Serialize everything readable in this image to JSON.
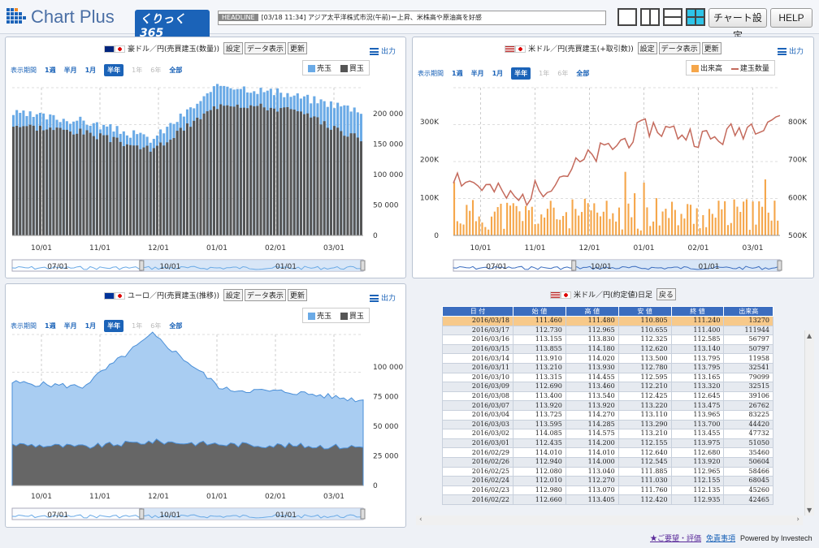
{
  "header": {
    "logo_text": "Chart Plus",
    "logo_badge": "くりっく365",
    "headline_tag": "HEADLINE",
    "headline_text": "[03/18 11:34] アジア太平洋株式市況(午前)＝上昇、米株高や原油高を好感",
    "settings_label": "チャート設定",
    "help_label": "HELP"
  },
  "common": {
    "settings_btn": "設定",
    "data_btn": "データ表示",
    "refresh_btn": "更新",
    "export_label": "出力",
    "period_label": "表示期間",
    "periods": [
      "1週",
      "半月",
      "1月",
      "半年",
      "1年",
      "6年",
      "全部"
    ]
  },
  "panel1": {
    "title": "豪ドル／円(売買建玉(数量))",
    "legend_sell": "売玉",
    "legend_buy": "買玉",
    "y_ticks": [
      "200 000",
      "150 000",
      "100 000",
      "50 000",
      "0"
    ],
    "x_ticks": [
      "10/01",
      "11/01",
      "12/01",
      "01/01",
      "02/01",
      "03/01"
    ],
    "nav_ticks": [
      "07/01",
      "10/01",
      "01/01"
    ]
  },
  "panel2": {
    "title": "米ドル／円(売買建玉(+取引数))",
    "legend_volume": "出来高",
    "legend_oi": "建玉数量",
    "y_left_ticks": [
      "300K",
      "200K",
      "100K",
      "0"
    ],
    "y_right_ticks": [
      "800K",
      "700K",
      "600K",
      "500K"
    ],
    "x_ticks": [
      "10/01",
      "11/01",
      "12/01",
      "01/01",
      "02/01",
      "03/01"
    ],
    "nav_ticks": [
      "07/01",
      "10/01",
      "01/01"
    ]
  },
  "panel3": {
    "title": "ユーロ／円(売買建玉(推移))",
    "legend_sell": "売玉",
    "legend_buy": "買玉",
    "y_ticks": [
      "100 000",
      "75 000",
      "50 000",
      "25 000",
      "0"
    ],
    "x_ticks": [
      "10/01",
      "11/01",
      "12/01",
      "01/01",
      "02/01",
      "03/01"
    ],
    "nav_ticks": [
      "07/01",
      "10/01",
      "01/01"
    ]
  },
  "panel4": {
    "title": "米ドル／円(約定値)日足",
    "back_btn": "戻る",
    "columns": [
      "日 付",
      "始 値",
      "高 値",
      "安 値",
      "終 値",
      "出来高"
    ],
    "rows": [
      [
        "2016/03/18",
        "111.460",
        "111.480",
        "110.805",
        "111.240",
        "13270"
      ],
      [
        "2016/03/17",
        "112.730",
        "112.965",
        "110.655",
        "111.400",
        "111944"
      ],
      [
        "2016/03/16",
        "113.155",
        "113.830",
        "112.325",
        "112.585",
        "56797"
      ],
      [
        "2016/03/15",
        "113.855",
        "114.180",
        "112.620",
        "113.140",
        "50797"
      ],
      [
        "2016/03/14",
        "113.910",
        "114.020",
        "113.500",
        "113.795",
        "11958"
      ],
      [
        "2016/03/11",
        "113.210",
        "113.930",
        "112.780",
        "113.795",
        "32541"
      ],
      [
        "2016/03/10",
        "113.315",
        "114.455",
        "112.595",
        "113.165",
        "79099"
      ],
      [
        "2016/03/09",
        "112.690",
        "113.460",
        "112.210",
        "113.320",
        "32515"
      ],
      [
        "2016/03/08",
        "113.400",
        "113.540",
        "112.425",
        "112.645",
        "39106"
      ],
      [
        "2016/03/07",
        "113.920",
        "113.920",
        "113.220",
        "113.475",
        "26762"
      ],
      [
        "2016/03/04",
        "113.725",
        "114.270",
        "113.110",
        "113.965",
        "83225"
      ],
      [
        "2016/03/03",
        "113.595",
        "114.285",
        "113.290",
        "113.700",
        "44420"
      ],
      [
        "2016/03/02",
        "114.085",
        "114.575",
        "113.210",
        "113.455",
        "47732"
      ],
      [
        "2016/03/01",
        "112.435",
        "114.200",
        "112.155",
        "113.975",
        "51050"
      ],
      [
        "2016/02/29",
        "114.010",
        "114.010",
        "112.640",
        "112.680",
        "35460"
      ],
      [
        "2016/02/26",
        "112.940",
        "114.000",
        "112.545",
        "113.920",
        "50604"
      ],
      [
        "2016/02/25",
        "112.080",
        "113.040",
        "111.885",
        "112.965",
        "58466"
      ],
      [
        "2016/02/24",
        "112.010",
        "112.270",
        "111.030",
        "112.155",
        "68045"
      ],
      [
        "2016/02/23",
        "112.980",
        "113.070",
        "111.760",
        "112.135",
        "45260"
      ],
      [
        "2016/02/22",
        "112.660",
        "113.405",
        "112.420",
        "112.935",
        "42465"
      ]
    ]
  },
  "footer": {
    "feedback": "★ご要望・評価",
    "disclaimer": "免責事項",
    "powered": "Powered by Investech"
  },
  "colors": {
    "sell": "#6aaae6",
    "buy": "#555555",
    "volume": "#f5a64a",
    "oi": "#c46a5c",
    "accent": "#1b63b8"
  },
  "chart_data": [
    {
      "type": "bar",
      "title": "豪ドル／円(売買建玉(数量))",
      "categories": [
        "10/01",
        "11/01",
        "12/01",
        "01/01",
        "02/01",
        "03/01"
      ],
      "series": [
        {
          "name": "売玉",
          "values": [
            165000,
            155000,
            130000,
            205000,
            190000,
            170000
          ]
        },
        {
          "name": "買玉",
          "values": [
            150000,
            140000,
            115000,
            180000,
            170000,
            130000
          ]
        }
      ],
      "ylim": [
        0,
        200000
      ]
    },
    {
      "type": "bar",
      "title": "米ドル／円(売買建玉(+取引数))",
      "categories": [
        "10/01",
        "11/01",
        "12/01",
        "01/01",
        "02/01",
        "03/01"
      ],
      "series": [
        {
          "name": "出来高",
          "values": [
            60000,
            30000,
            70000,
            40000,
            50000,
            80000
          ]
        },
        {
          "name": "建玉数量",
          "values": [
            620000,
            560000,
            650000,
            730000,
            700000,
            760000
          ]
        }
      ]
    },
    {
      "type": "area",
      "title": "ユーロ／円(売買建玉(推移))",
      "categories": [
        "10/01",
        "11/01",
        "12/01",
        "01/01",
        "02/01",
        "03/01"
      ],
      "series": [
        {
          "name": "売玉",
          "values": [
            75000,
            72000,
            110000,
            70000,
            68000,
            62000
          ]
        },
        {
          "name": "買玉",
          "values": [
            30000,
            28000,
            32000,
            30000,
            29000,
            28000
          ]
        }
      ],
      "ylim": [
        0,
        110000
      ]
    }
  ]
}
